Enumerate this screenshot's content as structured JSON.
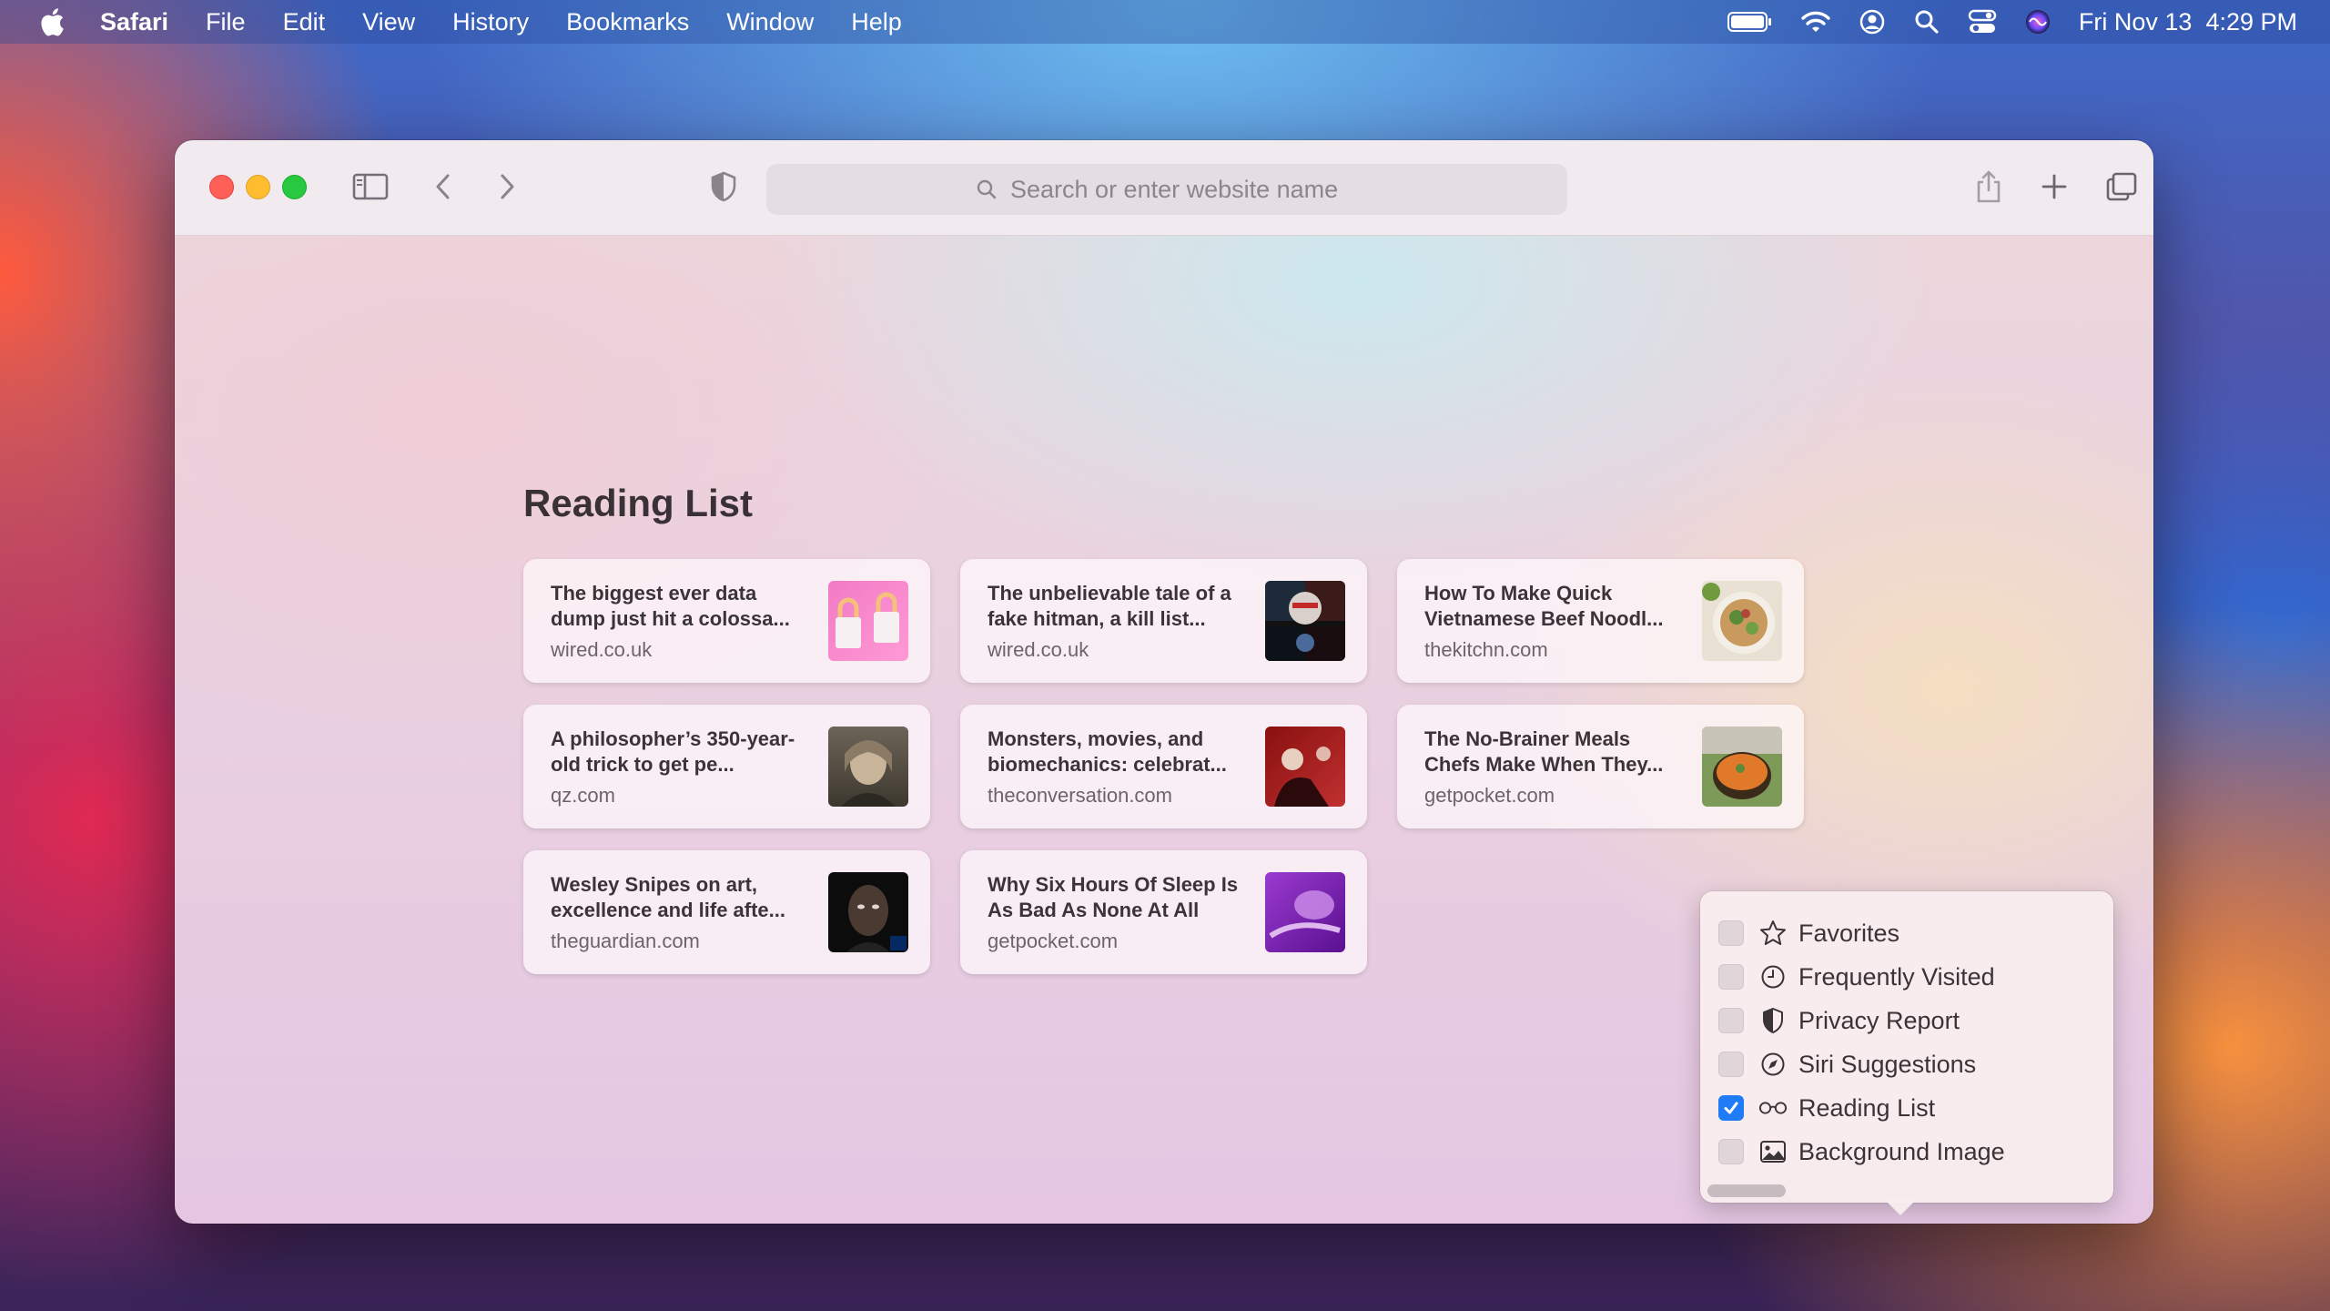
{
  "menubar": {
    "app": "Safari",
    "items": [
      "File",
      "Edit",
      "View",
      "History",
      "Bookmarks",
      "Window",
      "Help"
    ],
    "clock": "Fri Nov 13  4:29 PM"
  },
  "toolbar": {
    "search_placeholder": "Search or enter website name"
  },
  "reading_list": {
    "title": "Reading List",
    "cards": [
      {
        "title": "The biggest ever data dump just hit a colossa...",
        "domain": "wired.co.uk"
      },
      {
        "title": "The unbelievable tale of a fake hitman, a kill list...",
        "domain": "wired.co.uk"
      },
      {
        "title": "How To Make Quick Vietnamese Beef Noodl...",
        "domain": "thekitchn.com"
      },
      {
        "title": "A philosopher’s 350-year-old trick to get pe...",
        "domain": "qz.com"
      },
      {
        "title": "Monsters, movies, and biomechanics: celebrat...",
        "domain": "theconversation.com"
      },
      {
        "title": "The No-Brainer Meals Chefs Make When They...",
        "domain": "getpocket.com"
      },
      {
        "title": "Wesley Snipes on art, excellence and life afte...",
        "domain": "theguardian.com"
      },
      {
        "title": "Why Six Hours Of Sleep Is As Bad As None At All",
        "domain": "getpocket.com"
      }
    ]
  },
  "customize_popover": {
    "items": [
      {
        "label": "Favorites",
        "checked": false,
        "icon": "star-icon"
      },
      {
        "label": "Frequently Visited",
        "checked": false,
        "icon": "clock-icon"
      },
      {
        "label": "Privacy Report",
        "checked": false,
        "icon": "shield-icon"
      },
      {
        "label": "Siri Suggestions",
        "checked": false,
        "icon": "compass-icon"
      },
      {
        "label": "Reading List",
        "checked": true,
        "icon": "glasses-icon"
      },
      {
        "label": "Background Image",
        "checked": false,
        "icon": "photo-icon"
      }
    ]
  }
}
